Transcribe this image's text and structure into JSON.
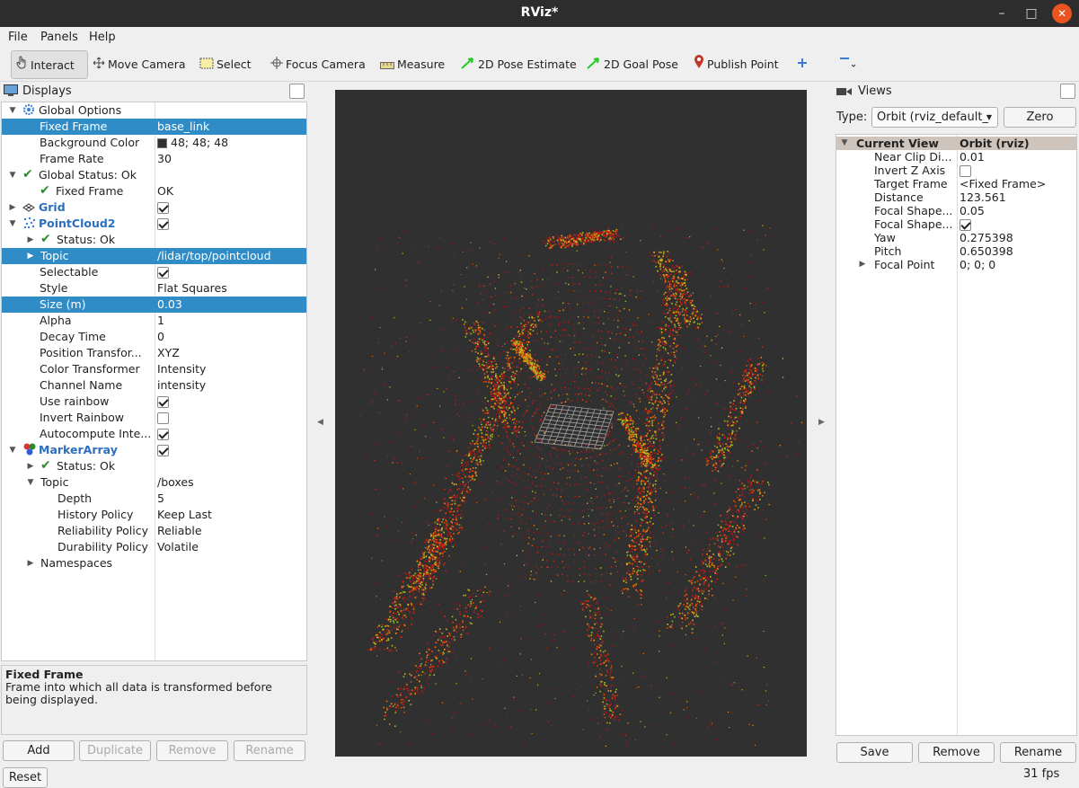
{
  "window": {
    "title": "RViz*"
  },
  "menubar": [
    "File",
    "Panels",
    "Help"
  ],
  "toolbar": [
    {
      "label": "Interact",
      "icon": "hand-pointer-icon",
      "active": true
    },
    {
      "label": "Move Camera",
      "icon": "move-camera-icon"
    },
    {
      "label": "Select",
      "icon": "select-box-icon"
    },
    {
      "label": "Focus Camera",
      "icon": "focus-crosshair-icon"
    },
    {
      "label": "Measure",
      "icon": "ruler-icon"
    },
    {
      "label": "2D Pose Estimate",
      "icon": "green-arrow-icon"
    },
    {
      "label": "2D Goal Pose",
      "icon": "green-arrow-icon"
    },
    {
      "label": "Publish Point",
      "icon": "map-pin-icon"
    }
  ],
  "displays": {
    "title": "Displays",
    "rows": [
      {
        "label": "Global Options",
        "value": ""
      },
      {
        "label": "Fixed Frame",
        "value": "base_link"
      },
      {
        "label": "Background Color",
        "value": "48; 48; 48"
      },
      {
        "label": "Frame Rate",
        "value": "30"
      },
      {
        "label": "Global Status: Ok",
        "value": ""
      },
      {
        "label": "Fixed Frame",
        "value": "OK"
      },
      {
        "label": "Grid",
        "value": ""
      },
      {
        "label": "PointCloud2",
        "value": ""
      },
      {
        "label": "Status: Ok",
        "value": ""
      },
      {
        "label": "Topic",
        "value": "/lidar/top/pointcloud"
      },
      {
        "label": "Selectable",
        "value": ""
      },
      {
        "label": "Style",
        "value": "Flat Squares"
      },
      {
        "label": "Size (m)",
        "value": "0.03"
      },
      {
        "label": "Alpha",
        "value": "1"
      },
      {
        "label": "Decay Time",
        "value": "0"
      },
      {
        "label": "Position Transfor...",
        "value": "XYZ"
      },
      {
        "label": "Color Transformer",
        "value": "Intensity"
      },
      {
        "label": "Channel Name",
        "value": "intensity"
      },
      {
        "label": "Use rainbow",
        "value": ""
      },
      {
        "label": "Invert Rainbow",
        "value": ""
      },
      {
        "label": "Autocompute Inte...",
        "value": ""
      },
      {
        "label": "MarkerArray",
        "value": ""
      },
      {
        "label": "Status: Ok",
        "value": ""
      },
      {
        "label": "Topic",
        "value": "/boxes"
      },
      {
        "label": "Depth",
        "value": "5"
      },
      {
        "label": "History Policy",
        "value": "Keep Last"
      },
      {
        "label": "Reliability Policy",
        "value": "Reliable"
      },
      {
        "label": "Durability Policy",
        "value": "Volatile"
      },
      {
        "label": "Namespaces",
        "value": ""
      }
    ],
    "checked": {
      "grid": true,
      "pointcloud2": true,
      "selectable": true,
      "use_rainbow": true,
      "invert_rainbow": false,
      "autocompute": true,
      "markerarray": true
    }
  },
  "description": {
    "title": "Fixed Frame",
    "text": "Frame into which all data is transformed before being displayed."
  },
  "buttons": {
    "add": "Add",
    "duplicate": "Duplicate",
    "remove": "Remove",
    "rename": "Rename",
    "reset": "Reset"
  },
  "views": {
    "title": "Views",
    "type_label": "Type:",
    "type_value": "Orbit (rviz_default_",
    "zero": "Zero",
    "header": {
      "label": "Current View",
      "value": "Orbit (rviz)"
    },
    "rows": [
      {
        "label": "Near Clip Di...",
        "value": "0.01"
      },
      {
        "label": "Invert Z Axis",
        "value": ""
      },
      {
        "label": "Target Frame",
        "value": "<Fixed Frame>"
      },
      {
        "label": "Distance",
        "value": "123.561"
      },
      {
        "label": "Focal Shape...",
        "value": "0.05"
      },
      {
        "label": "Focal Shape...",
        "value": ""
      },
      {
        "label": "Yaw",
        "value": "0.275398"
      },
      {
        "label": "Pitch",
        "value": "0.650398"
      },
      {
        "label": "Focal Point",
        "value": "0; 0; 0"
      }
    ],
    "checked": {
      "invert_z": false,
      "focal_shape_fixed": true
    },
    "save": "Save",
    "remove": "Remove",
    "rename": "Rename"
  },
  "status": {
    "fps": "31 fps"
  },
  "colors": {
    "background": "#303030",
    "selection": "#308cc6",
    "accent": "#2c6fbf",
    "ok": "#2a8f2a",
    "close_button": "#e95420"
  }
}
